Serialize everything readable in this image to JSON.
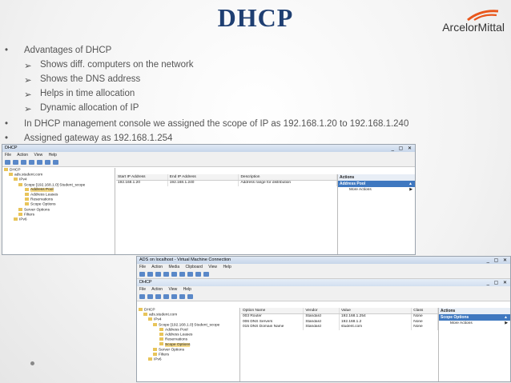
{
  "slide": {
    "title": "DHCP",
    "logo_text": "ArcelorMittal",
    "logo_color": "#e8571c",
    "bullets": [
      {
        "symbol": "•",
        "text": "Advantages of DHCP"
      },
      {
        "symbol": "➢",
        "text": "Shows diff. computers on the network"
      },
      {
        "symbol": "➢",
        "text": "Shows the DNS address"
      },
      {
        "symbol": "➢",
        "text": "Helps in time allocation"
      },
      {
        "symbol": "➢",
        "text": "Dynamic allocation of IP"
      },
      {
        "symbol": "•",
        "text": "In DHCP management console we assigned the scope of IP as 192.168.1.20 to 192.168.1.240"
      },
      {
        "symbol": "•",
        "text": "Assigned gateway as 192.168.1.254"
      }
    ]
  },
  "win1": {
    "title": "DHCP",
    "menu": [
      "File",
      "Action",
      "View",
      "Help"
    ],
    "tree": [
      "DHCP",
      "ads.student.com",
      "IPv4",
      "Scope [192.168.1.0] Student_scope",
      "Address Pool",
      "Address Leases",
      "Reservations",
      "Scope Options",
      "Server Options",
      "Filters",
      "IPv6"
    ],
    "columns": [
      "Start IP Address",
      "End IP Address",
      "Description"
    ],
    "rows": [
      [
        "192.168.1.20",
        "192.168.1.240",
        "Address range for distribution"
      ]
    ],
    "actions_header": "Actions",
    "actions_selected": "Address Pool",
    "actions_item": "More Actions"
  },
  "win2": {
    "title": "ADS on localhost - Virtual Machine Connection",
    "menu": [
      "File",
      "Action",
      "Media",
      "Clipboard",
      "View",
      "Help"
    ],
    "inner_title": "DHCP",
    "inner_menu": [
      "File",
      "Action",
      "View",
      "Help"
    ],
    "tree": [
      "DHCP",
      "ads.student.com",
      "IPv4",
      "Scope [192.168.1.0] Student_scope",
      "Address Pool",
      "Address Leases",
      "Reservations",
      "Scope Options",
      "Server Options",
      "Filters",
      "IPv6"
    ],
    "columns": [
      "Option Name",
      "Vendor",
      "Value",
      "Class"
    ],
    "rows": [
      [
        "003 Router",
        "Standard",
        "192.168.1.254",
        "None"
      ],
      [
        "006 DNS Servers",
        "Standard",
        "192.168.1.2",
        "None"
      ],
      [
        "015 DNS Domain Name",
        "Standard",
        "student.com",
        "None"
      ]
    ],
    "actions_header": "Actions",
    "actions_selected": "Scope Options",
    "actions_item": "More Actions"
  }
}
